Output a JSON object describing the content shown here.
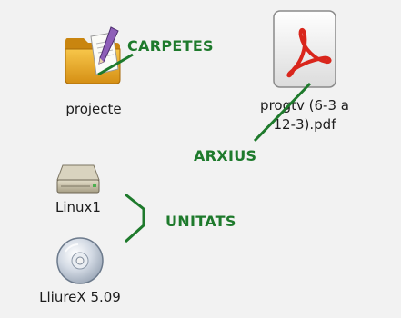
{
  "desktop": {
    "items": [
      {
        "name": "projecte",
        "icon": "folder-icon"
      },
      {
        "name_line1": "progtv (6-3 a",
        "name_line2": "12-3).pdf",
        "icon": "pdf-file-icon"
      },
      {
        "name": "Linux1",
        "icon": "hard-drive-icon"
      },
      {
        "name": "LliureX 5.09",
        "icon": "cd-drive-icon"
      }
    ]
  },
  "annotations": {
    "folders": "CARPETES",
    "files": "ARXIUS",
    "units": "UNITATS"
  },
  "colors": {
    "annotation": "#1e7a2c",
    "background": "#f2f2f2",
    "pdf_accent": "#d9261c"
  }
}
